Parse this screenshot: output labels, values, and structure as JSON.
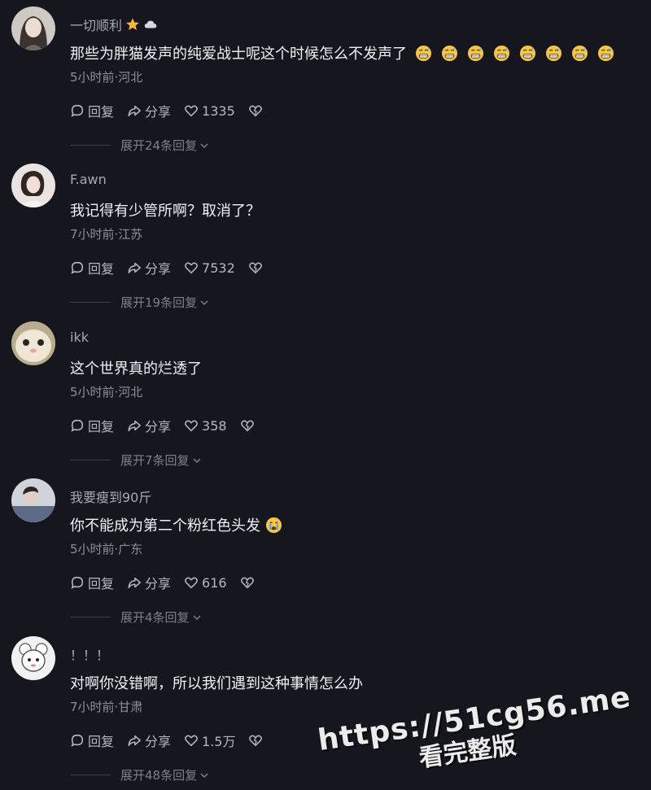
{
  "comments": [
    {
      "username": "一切顺利",
      "badges": [
        "star-icon",
        "cloud-icon"
      ],
      "content": "那些为胖猫发声的纯爱战士呢这个时候怎么不发声了",
      "emoji_name": "grimacing-sweat-emoji",
      "emoji_count": 8,
      "meta": "5小时前·河北",
      "reply_label": "回复",
      "share_label": "分享",
      "likes": "1335",
      "expand_label": "展开24条回复"
    },
    {
      "username": "F.awn",
      "content": "我记得有少管所啊？取消了？",
      "meta": "7小时前·江苏",
      "reply_label": "回复",
      "share_label": "分享",
      "likes": "7532",
      "expand_label": "展开19条回复"
    },
    {
      "username": "ikk",
      "content": "这个世界真的烂透了",
      "meta": "5小时前·河北",
      "reply_label": "回复",
      "share_label": "分享",
      "likes": "358",
      "expand_label": "展开7条回复"
    },
    {
      "username": "我要瘦到90斤",
      "content": "你不能成为第二个粉红色头发",
      "emoji_name": "crying-emoji",
      "meta": "5小时前·广东",
      "reply_label": "回复",
      "share_label": "分享",
      "likes": "616",
      "expand_label": "展开4条回复"
    },
    {
      "username": "！！！",
      "content": "对啊你没错啊，所以我们遇到这种事情怎么办",
      "meta": "7小时前·甘肃",
      "reply_label": "回复",
      "share_label": "分享",
      "likes": "1.5万",
      "expand_label": "展开48条回复"
    }
  ],
  "watermark": {
    "url": "https://51cg56.me",
    "subtitle": "看完整版"
  },
  "colors": {
    "background": "#16161e",
    "text_primary": "#f1f1f3",
    "text_secondary": "#8e8e98",
    "star": "#f5b82e"
  }
}
